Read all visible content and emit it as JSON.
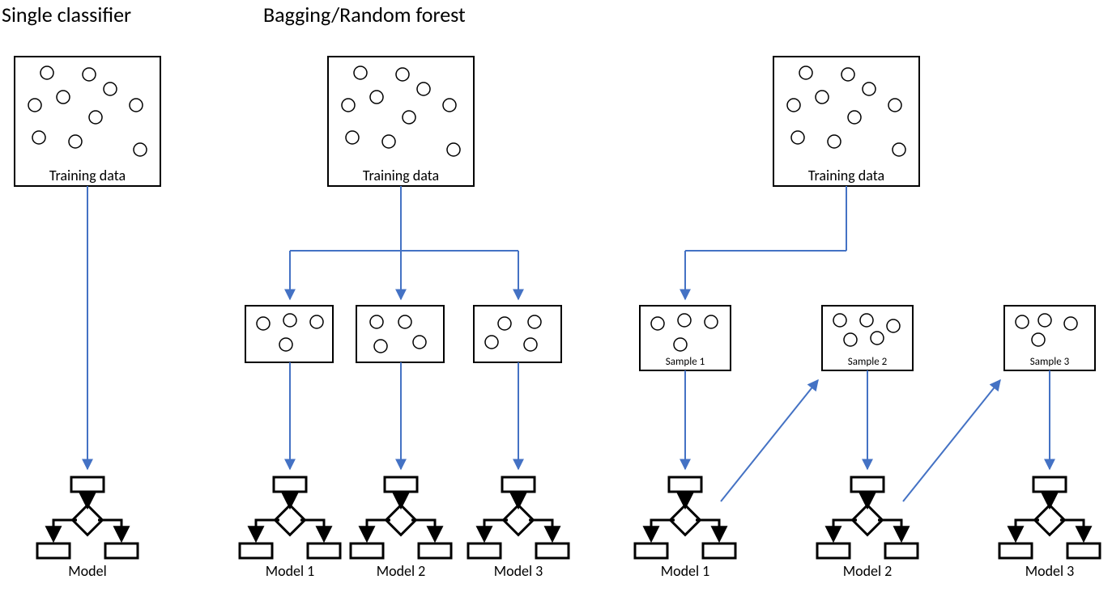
{
  "titles": {
    "single": "Single classifier",
    "bagging": "Bagging/Random forest"
  },
  "labels": {
    "training_data": "Training data",
    "sample1": "Sample 1",
    "sample2": "Sample 2",
    "sample3": "Sample 3",
    "model": "Model",
    "model1": "Model 1",
    "model2": "Model 2",
    "model3": "Model 3"
  }
}
